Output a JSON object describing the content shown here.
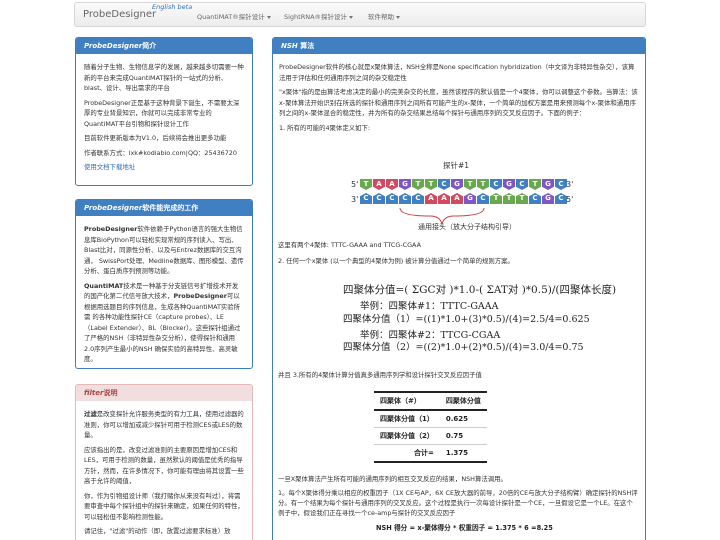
{
  "nav": {
    "brand": "ProbeDesigner",
    "beta": "English beta",
    "items": [
      {
        "label": "QuantiMAT®探针设计"
      },
      {
        "label": "SightRNA®探针设计"
      },
      {
        "label": "软件帮助"
      }
    ]
  },
  "intro_panel": {
    "title_italic": "ProbeDesigner",
    "title_rest": "简介",
    "p1": "随着分子生物、生物信息学的发展，越来越多切需要一种新的平台来完成QuantiMAT探针的一站式的分析、blast、设计、导出需求的平台",
    "p2": "ProbeDesigner正是基于这种背景下诞生，不需要太深厚的专业背景知识，你就可以完成非常专业的QuantiMAT平台引物和探针设计工作",
    "p3": "目前软件更新版本为V1.0，后续将会推出更多功能",
    "p4": "作者联系方式：lxk#kodiabio.com|QQ：25436720",
    "link": "使用文档下载地址"
  },
  "features_panel": {
    "title_italic": "ProbeDesigner",
    "title_rest": "软件能完成的工作",
    "p1_bold": "ProbeDesigner",
    "p1": "软件依赖于Python语言的强大生物信息库BioPython可以轻松实现常规的序列读入、写出、Blast比对，同源性分析、以及与Entrez数据库的交互沟通， SwissPort处理、Medline数据库、图形模型、遗传分析、蛋白质序列预测等功能。",
    "p2_bold": "QuantiMAT",
    "p2": "技术是一种基于分支链信号扩增技术开发的国产化第二代信号放大技术，",
    "p2_bold2": "ProbeDesigner",
    "p2_rest": "可以根据用选题目的序列信息，生成各种QuantiMAT实验所需 的各种功能性探针CE（capture probes）、LE（Label Extender）、BL（Blocker）。这些探针组通过了严格的NSH（非特异性杂交分析），使得探针和通用2.0序列产生最小的NSH 确保实验的高特异性、高灵敏度。"
  },
  "filter_panel": {
    "title_italic": "filter",
    "title_rest": "说明",
    "p1_bold": "过滤",
    "p1": "是改变探针允许服务类型的有力工具，使用过滤器的准则，你可以增加或减少探针可用于检测CES或LES的数量。",
    "p2": "应该指出的是，改变过滤准则的主要原因是增加CES和LES，可用于检测的数量，虽然默认的阈值是优秀的指导方针，然而，在许多情况下，你可能有理由将其设置一些高于允许的阈值，",
    "p3": "你，作为引物组设计师（我打赌你从来没有叫过），将需要审查中每个探针组中的探针来确定，如果任何的特性，可以轻松但不影响检测性能。",
    "p4": "请记住，\"过滤\"的动作（即，放置过滤要求标准）放"
  },
  "nsh_panel": {
    "title_italic": "NSH",
    "title_rest": " 算法",
    "p1": "ProbeDesigner软件的核心就是x聚体算法，NSH全称是None specification hybridization（中文译为非特异性杂交），该算法用于评估和任何通用序列之间的杂交稳定性",
    "p2": "\"x聚体\"指的是由算法考虑决定的最小的完美杂交的长度，虽然该程序的默认值是一个4聚体，你可以调整这个参数。当算法：该x-聚体算法开始识别在所选的探针和通用序列之间所有可能产生的x-聚体，一个简单的加权方案是用来预测每个x-聚体和通用序列之间的x-聚体混合的稳定性，并为所有的杂交结果总结每个探针与通用序列的交叉反应因子。下面的例子：",
    "step1": "1. 所有的可能的4聚体定义如下:",
    "probe_label": "探针#1",
    "strand_top": [
      "T",
      "A",
      "A",
      "G",
      "T",
      "T",
      "C",
      "G",
      "T",
      "T",
      "C",
      "G",
      "C",
      "T",
      "G",
      "C"
    ],
    "strand_bottom": [
      "C",
      "C",
      "C",
      "C",
      "C",
      "A",
      "A",
      "A",
      "G",
      "C",
      "T",
      "T",
      "T",
      "C",
      "G",
      "C"
    ],
    "end5": "5'",
    "end3": "3'",
    "universal_label": "通用接头（放大分子结构引导）",
    "found": "这里有两个4聚体: TTTC-GAAA and TTCG-CGAA",
    "step2": "2. 任何一个x聚体 (以一个典型的4聚体为例) 被计算分值通过一个简单的规则方案。",
    "formula": "四聚体分值=( ΣGC对 )*1.0-( ΣAT对 )*0.5)/(四聚体长度)",
    "ex1_title": "举例：四聚体#1：TTTC-GAAA",
    "ex1_calc": "四聚体分值（1）=((1)*1.0+(3)*0.5)/(4)=2.5/4=0.625",
    "ex2_title": "举例：四聚体#2：TTCG-CGAA",
    "ex2_calc": "四聚体分值（2）=((2)*1.0+(2)*0.5)/(4)=3.0/4=0.75",
    "step3": "并且 3.所有的4聚体计算分值真多通用序列学和设计探针交叉反应因子值",
    "table": {
      "headers": [
        "四聚体（#）",
        "四聚体分值"
      ],
      "rows": [
        [
          "四聚体分值（1）",
          "0.625"
        ],
        [
          "四聚体分值（2）",
          "0.75"
        ],
        [
          "合计=",
          "1.375"
        ]
      ]
    },
    "p_after": "一旦X聚体算法产生所有可能的通用序列的相互交叉反应的结果，NSH算法调用。",
    "p_weight": "1。每个X聚体得分乘以相应的权重因子（1X CE与AP，6X CE放大器的前导，20倍的CE与放大分子结构臂）确定探针的NSH评分。有一个结果为每个探针与通用序列的交叉反应。这个过程是执行一次每设计探针是一个CE，一旦假设它是一个LE。在这个例子中，假设我们正在寻找一个ce-amp与探针的交叉反应因子",
    "nsh_score": "NSH 得分 = x-聚体得分 * 权重因子 = 1.375 * 6 =8.25"
  }
}
